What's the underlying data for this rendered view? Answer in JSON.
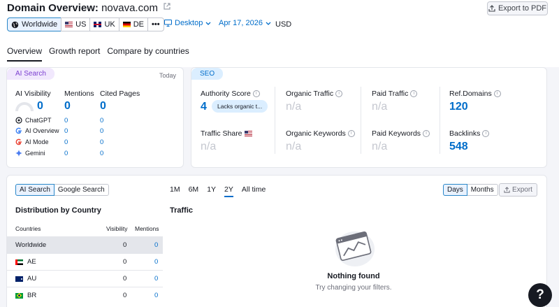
{
  "header": {
    "title_prefix": "Domain Overview:",
    "domain": "novava.com",
    "export_pdf_label": "Export to PDF"
  },
  "databases": [
    {
      "label": "Worldwide",
      "icon": "globe-icon"
    },
    {
      "label": "US",
      "icon": "flag-us-icon"
    },
    {
      "label": "UK",
      "icon": "flag-uk-icon"
    },
    {
      "label": "DE",
      "icon": "flag-de-icon"
    },
    {
      "label": "•••",
      "icon": "more-icon"
    }
  ],
  "device": "Desktop",
  "date": "Apr 17, 2026",
  "currency": "USD",
  "tabs": [
    "Overview",
    "Growth report",
    "Compare by countries"
  ],
  "ai_search": {
    "chip": "AI Search",
    "period": "Today",
    "visibility_label": "AI Visibility",
    "visibility_value": "0",
    "mentions_label": "Mentions",
    "mentions_value": "0",
    "cited_label": "Cited Pages",
    "cited_value": "0",
    "sources": [
      {
        "name": "ChatGPT",
        "mentions": "0",
        "cited": "0"
      },
      {
        "name": "AI Overview",
        "mentions": "0",
        "cited": "0"
      },
      {
        "name": "AI Mode",
        "mentions": "0",
        "cited": "0"
      },
      {
        "name": "Gemini",
        "mentions": "0",
        "cited": "0"
      }
    ]
  },
  "seo": {
    "chip": "SEO",
    "authority_label": "Authority Score",
    "authority_value": "4",
    "authority_note": "Lacks organic t...",
    "organic_traffic_label": "Organic Traffic",
    "organic_traffic_value": "n/a",
    "paid_traffic_label": "Paid Traffic",
    "paid_traffic_value": "n/a",
    "ref_domains_label": "Ref.Domains",
    "ref_domains_value": "120",
    "traffic_share_label": "Traffic Share",
    "traffic_share_value": "n/a",
    "organic_keywords_label": "Organic Keywords",
    "organic_keywords_value": "n/a",
    "paid_keywords_label": "Paid Keywords",
    "paid_keywords_value": "n/a",
    "backlinks_label": "Backlinks",
    "backlinks_value": "548"
  },
  "bottom": {
    "source_toggle": [
      "AI Search",
      "Google Search"
    ],
    "periods": [
      "1M",
      "6M",
      "1Y",
      "2Y",
      "All time"
    ],
    "active_period": "2Y",
    "granularity": [
      "Days",
      "Months"
    ],
    "export_label": "Export",
    "distribution_title": "Distribution by Country",
    "traffic_title": "Traffic",
    "columns": [
      "Countries",
      "Visibility",
      "Mentions"
    ],
    "rows": [
      {
        "country": "Worldwide",
        "visibility": "0",
        "mentions": "0",
        "flag": ""
      },
      {
        "country": "AE",
        "visibility": "0",
        "mentions": "0",
        "flag": "flag-ae-icon"
      },
      {
        "country": "AU",
        "visibility": "0",
        "mentions": "0",
        "flag": "flag-au-icon"
      },
      {
        "country": "BR",
        "visibility": "0",
        "mentions": "0",
        "flag": "flag-br-icon"
      }
    ],
    "empty_title": "Nothing found",
    "empty_subtitle": "Try changing your filters."
  },
  "help_label": "?"
}
